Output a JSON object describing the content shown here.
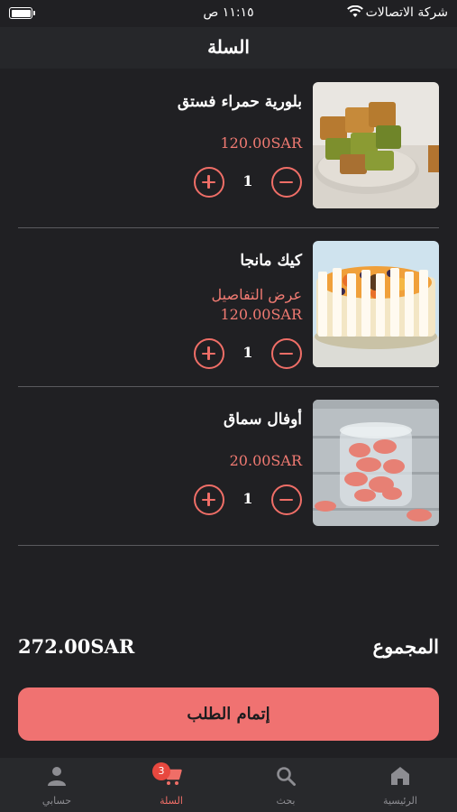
{
  "status_bar": {
    "carrier": "شركة الاتصالات",
    "time": "١١:١٥ ص"
  },
  "header": {
    "title": "السلة"
  },
  "cart": {
    "items": [
      {
        "name": "بلورية حمراء فستق",
        "price": "120.00SAR",
        "quantity": "1",
        "image": "pistachio-baklava-photo"
      },
      {
        "name": "كيك مانجا",
        "details_link": "عرض التفاصيل",
        "price": "120.00SAR",
        "quantity": "1",
        "image": "mango-cake-photo"
      },
      {
        "name": "أوفال سماق",
        "price": "20.00SAR",
        "quantity": "1",
        "image": "sumac-oval-cookies-photo"
      }
    ]
  },
  "summary": {
    "total_label": "المجموع",
    "total_value": "272.00SAR"
  },
  "checkout_button": {
    "label": "إتمام الطلب"
  },
  "tab_bar": {
    "tabs": [
      {
        "label": "الرئيسية",
        "icon": "home-icon"
      },
      {
        "label": "بحث",
        "icon": "search-icon"
      },
      {
        "label": "السلة",
        "icon": "cart-icon",
        "badge": "3",
        "active": true
      },
      {
        "label": "حسابي",
        "icon": "person-icon"
      }
    ]
  },
  "colors": {
    "background": "#202023",
    "accent": "#f07271",
    "price": "#f07a72",
    "badge": "#e8483f",
    "tab_inactive": "#8d8d92"
  }
}
